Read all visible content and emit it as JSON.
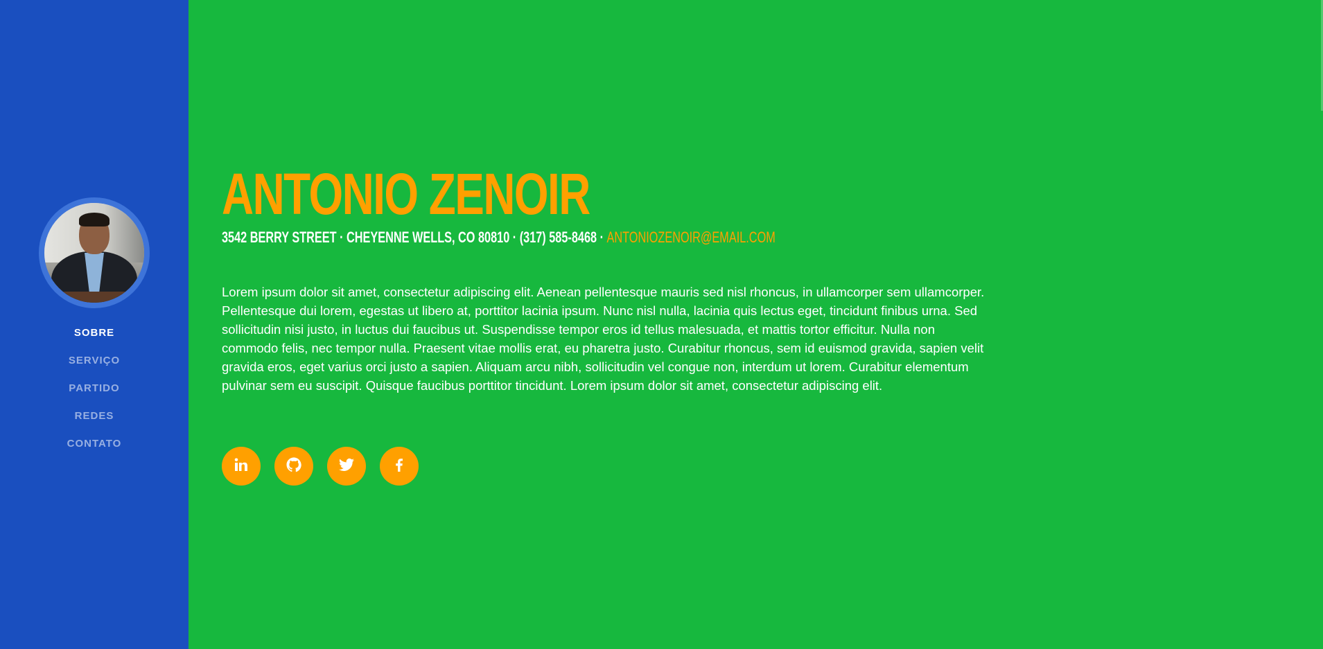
{
  "colors": {
    "sidebar": "#1a4fbf",
    "main": "#17b83e",
    "accent": "#ffa000",
    "text": "#ffffff"
  },
  "sidebar": {
    "nav": [
      {
        "label": "SOBRE",
        "active": true
      },
      {
        "label": "SERVIÇO",
        "active": false
      },
      {
        "label": "PARTIDO",
        "active": false
      },
      {
        "label": "REDES",
        "active": false
      },
      {
        "label": "CONTATO",
        "active": false
      }
    ]
  },
  "about": {
    "name": "ANTONIO ZENOIR",
    "address": "3542 BERRY STREET · CHEYENNE WELLS, CO 80810 · (317) 585-8468 · ",
    "email": "ANTONIOZENOIR@EMAIL.COM",
    "bio": "Lorem ipsum dolor sit amet, consectetur adipiscing elit. Aenean pellentesque mauris sed nisl rhoncus, in ullamcorper sem ullamcorper. Pellentesque dui lorem, egestas ut libero at, porttitor lacinia ipsum. Nunc nisl nulla, lacinia quis lectus eget, tincidunt finibus urna. Sed sollicitudin nisi justo, in luctus dui faucibus ut. Suspendisse tempor eros id tellus malesuada, et mattis tortor efficitur. Nulla non commodo felis, nec tempor nulla. Praesent vitae mollis erat, eu pharetra justo. Curabitur rhoncus, sem id euismod gravida, sapien velit gravida eros, eget varius orci justo a sapien. Aliquam arcu nibh, sollicitudin vel congue non, interdum ut lorem. Curabitur elementum pulvinar sem eu suscipit. Quisque faucibus porttitor tincidunt. Lorem ipsum dolor sit amet, consectetur adipiscing elit."
  },
  "socials": [
    {
      "icon": "linkedin-icon"
    },
    {
      "icon": "github-icon"
    },
    {
      "icon": "twitter-icon"
    },
    {
      "icon": "facebook-icon"
    }
  ]
}
